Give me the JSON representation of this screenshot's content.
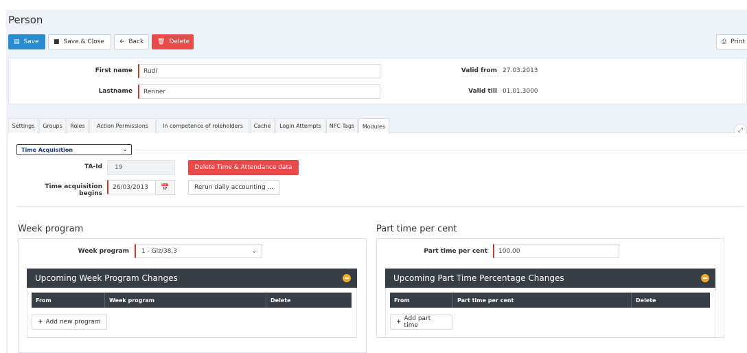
{
  "page": {
    "title": "Person"
  },
  "toolbar": {
    "save": "Save",
    "save_close": "Save & Close",
    "back": "Back",
    "delete": "Delete",
    "print": "Print"
  },
  "person": {
    "first_name_label": "First name",
    "first_name": "Rudi",
    "lastname_label": "Lastname",
    "lastname": "Renner",
    "valid_from_label": "Valid from",
    "valid_from": "27.03.2013",
    "valid_till_label": "Valid till",
    "valid_till": "01.01.3000"
  },
  "tabs": [
    {
      "label": "Settings"
    },
    {
      "label": "Groups"
    },
    {
      "label": "Roles"
    },
    {
      "label": "Action Permissions"
    },
    {
      "label": "In competence of roleholders"
    },
    {
      "label": "Cache"
    },
    {
      "label": "Login Attempts"
    },
    {
      "label": "NFC Tags"
    },
    {
      "label": "Modules",
      "active": true
    }
  ],
  "module": {
    "selected": "Time Acquisition",
    "ta_id_label": "TA-Id",
    "ta_id": "19",
    "begins_label": "Time acquisition begins",
    "begins": "26/03/2013",
    "delete_ta_button": "Delete Time & Attendance data",
    "rerun_button": "Rerun daily accounting ..."
  },
  "week_program": {
    "section_title": "Week program",
    "field_label": "Week program",
    "selected": "1 - Glz/38,3",
    "upcoming_title": "Upcoming Week Program Changes",
    "columns": [
      "From",
      "Week program",
      "Delete"
    ],
    "add_button": "Add new program"
  },
  "part_time": {
    "section_title": "Part time per cent",
    "field_label": "Part time per cent",
    "value": "100.00",
    "upcoming_title": "Upcoming Part Time Percentage Changes",
    "columns": [
      "From",
      "Part time per cent",
      "Delete"
    ],
    "add_button": "Add part time"
  },
  "icons": {
    "save": "floppy-icon",
    "save_close": "save-close-icon",
    "back": "arrow-left-icon",
    "delete": "trash-icon",
    "print": "printer-icon",
    "calendar": "calendar-icon",
    "plus": "plus-icon",
    "collapse": "minus-circle-icon",
    "expand": "expand-icon"
  },
  "colors": {
    "primary": "#2a8bd3",
    "danger": "#e94a4a",
    "dark_header": "#383e45",
    "collapse_dot": "#f0a92d",
    "page_bg": "#eef3f9"
  }
}
